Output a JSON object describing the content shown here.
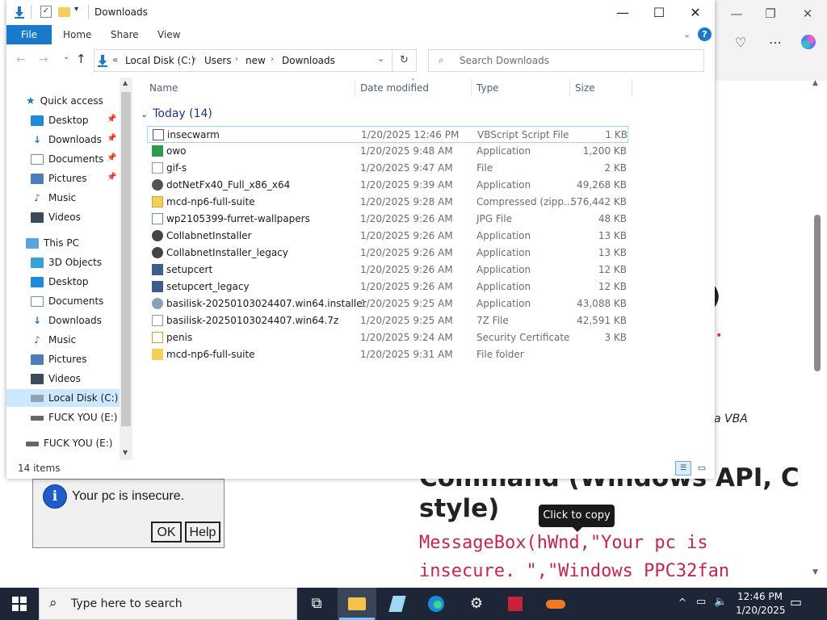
{
  "explorer": {
    "title": "Downloads",
    "ribbon": {
      "file": "File",
      "home": "Home",
      "share": "Share",
      "view": "View"
    },
    "breadcrumb": {
      "overflow": "«",
      "parts": [
        "Local Disk (C:)",
        "Users",
        "new",
        "Downloads"
      ]
    },
    "search_placeholder": "Search Downloads",
    "nav": {
      "quick_access": "Quick access",
      "qa_items": [
        "Desktop",
        "Downloads",
        "Documents",
        "Pictures",
        "Music",
        "Videos"
      ],
      "this_pc": "This PC",
      "pc_items": [
        "3D Objects",
        "Desktop",
        "Documents",
        "Downloads",
        "Music",
        "Pictures",
        "Videos",
        "Local Disk (C:)",
        "FUCK YOU (E:)"
      ],
      "drive": "FUCK YOU (E:)"
    },
    "columns": {
      "name": "Name",
      "date": "Date modified",
      "type": "Type",
      "size": "Size"
    },
    "group_label": "Today (14)",
    "files": [
      {
        "name": "insecwarm",
        "date": "1/20/2025 12:46 PM",
        "type": "VBScript Script File",
        "size": "1 KB"
      },
      {
        "name": "owo",
        "date": "1/20/2025 9:48 AM",
        "type": "Application",
        "size": "1,200 KB"
      },
      {
        "name": "gif-s",
        "date": "1/20/2025 9:47 AM",
        "type": "File",
        "size": "2 KB"
      },
      {
        "name": "dotNetFx40_Full_x86_x64",
        "date": "1/20/2025 9:39 AM",
        "type": "Application",
        "size": "49,268 KB"
      },
      {
        "name": "mcd-np6-full-suite",
        "date": "1/20/2025 9:28 AM",
        "type": "Compressed (zipp...",
        "size": "576,442 KB"
      },
      {
        "name": "wp2105399-furret-wallpapers",
        "date": "1/20/2025 9:26 AM",
        "type": "JPG File",
        "size": "48 KB"
      },
      {
        "name": "CollabnetInstaller",
        "date": "1/20/2025 9:26 AM",
        "type": "Application",
        "size": "13 KB"
      },
      {
        "name": "CollabnetInstaller_legacy",
        "date": "1/20/2025 9:26 AM",
        "type": "Application",
        "size": "13 KB"
      },
      {
        "name": "setupcert",
        "date": "1/20/2025 9:26 AM",
        "type": "Application",
        "size": "12 KB"
      },
      {
        "name": "setupcert_legacy",
        "date": "1/20/2025 9:26 AM",
        "type": "Application",
        "size": "12 KB"
      },
      {
        "name": "basilisk-20250103024407.win64.installer",
        "date": "1/20/2025 9:25 AM",
        "type": "Application",
        "size": "43,088 KB"
      },
      {
        "name": "basilisk-20250103024407.win64.7z",
        "date": "1/20/2025 9:25 AM",
        "type": "7Z File",
        "size": "42,591 KB"
      },
      {
        "name": "penis",
        "date": "1/20/2025 9:24 AM",
        "type": "Security Certificate",
        "size": "3 KB"
      },
      {
        "name": "mcd-np6-full-suite",
        "date": "1/20/2025 9:31 AM",
        "type": "File folder",
        "size": ""
      }
    ],
    "status": "14 items"
  },
  "msgbox": {
    "message": "Your pc is insecure.",
    "ok": "OK",
    "help": "Help"
  },
  "article": {
    "partial_heading": "t)",
    "partial_italic": "a VBA",
    "heading_line1": "Command (Windows API, C",
    "heading_line2": "style)",
    "code_line1": "MessageBox(hWnd,\"Your pc is",
    "code_line2": "insecure. \",\"Windows PPC32fan"
  },
  "tooltip": "Click to copy",
  "taskbar": {
    "search_placeholder": "Type here to search",
    "time": "12:46 PM",
    "date": "1/20/2025"
  },
  "colors": {
    "accent": "#1979ca",
    "taskbar": "#1c2636",
    "code": "#c7254e"
  }
}
